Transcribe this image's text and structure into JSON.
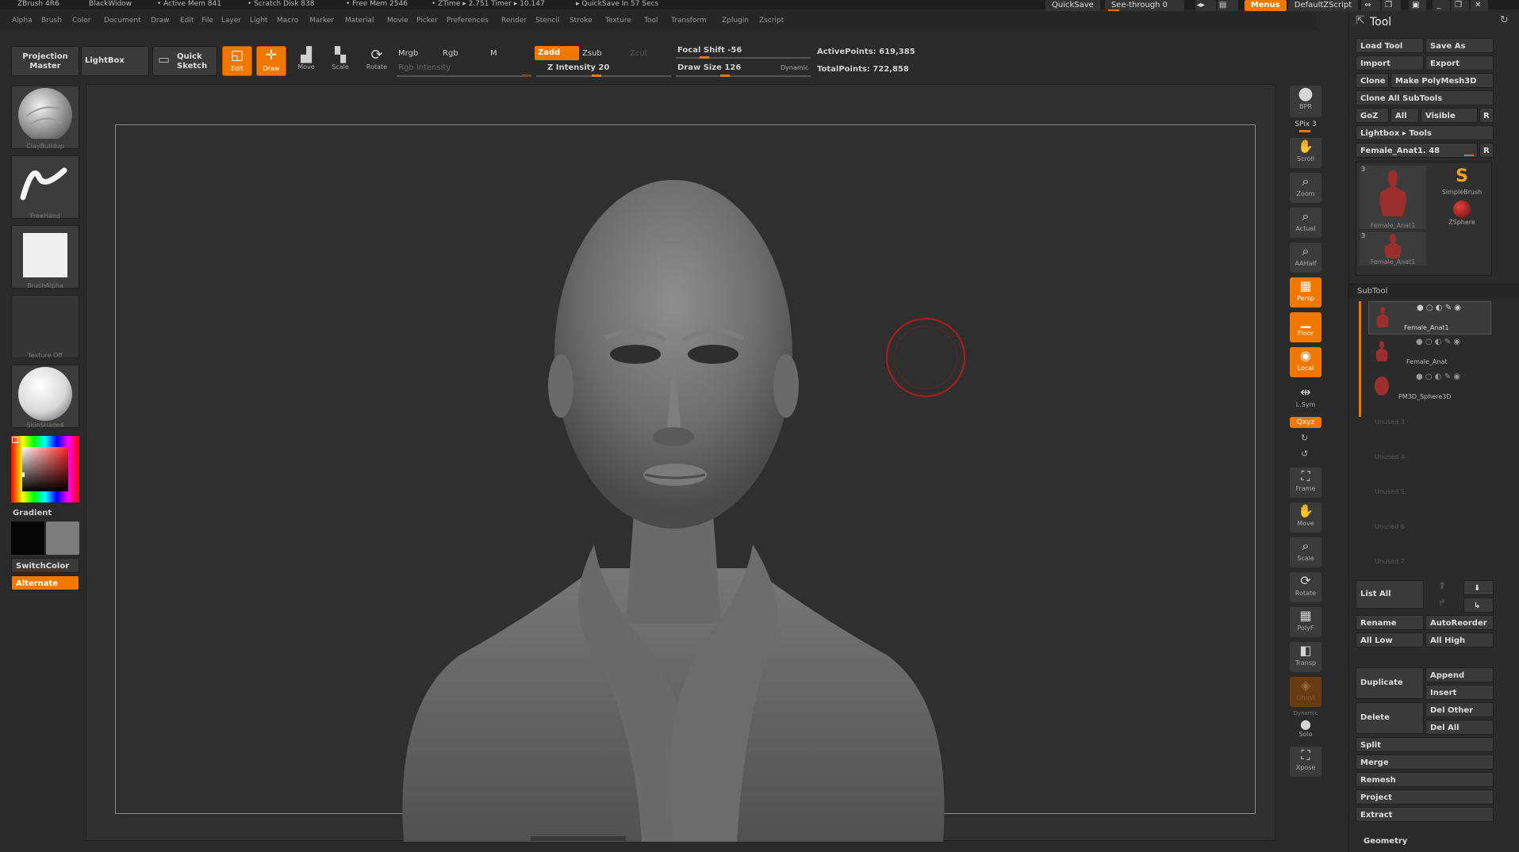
{
  "titlebar": {
    "app": "ZBrush 4R6",
    "doc": "BlackWidow",
    "active_mem": "• Active Mem 841",
    "scratch": "• Scratch Disk 838",
    "free_mem": "• Free Mem 2546",
    "ztime": "• ZTime ▸ 2.751  Timer ▸ 10.147",
    "quicksave_note": "▸ QuickSave In 57 Secs",
    "quicksave_btn": "QuickSave",
    "see_through": "See-through  0",
    "menus": "Menus",
    "default_zscript": "DefaultZScript"
  },
  "menubar": [
    "Alpha",
    "Brush",
    "Color",
    "Document",
    "Draw",
    "Edit",
    "File",
    "Layer",
    "Light",
    "Macro",
    "Marker",
    "Material",
    "Movie",
    "Picker",
    "Preferences",
    "Render",
    "Stencil",
    "Stroke",
    "Texture",
    "Tool",
    "Transform",
    "Zplugin",
    "Zscript"
  ],
  "toolbar": {
    "projection_master": "Projection Master",
    "lightbox": "LightBox",
    "quick_sketch": "Quick Sketch",
    "edit": "Edit",
    "draw": "Draw",
    "move": "Move",
    "scale": "Scale",
    "rotate": "Rotate",
    "mrgb": "Mrgb",
    "rgb": "Rgb",
    "m": "M",
    "rgb_intensity": "Rgb Intensity",
    "zadd": "Zadd",
    "zsub": "Zsub",
    "zcut": "Zcut",
    "z_intensity": "Z Intensity 20",
    "focal_shift": "Focal Shift -56",
    "draw_size": "Draw Size 126",
    "dynamic": "Dynamic",
    "active_points": "ActivePoints: 619,385",
    "total_points": "TotalPoints: 722,858"
  },
  "leftshelf": {
    "brush": "ClayBuildup",
    "stroke": "FreeHand",
    "alpha": "BrushAlpha",
    "texture": "Texture Off",
    "material": "SkinShade4",
    "gradient": "Gradient",
    "switchcolor": "SwitchColor",
    "alternate": "Alternate"
  },
  "rightshelf": {
    "bpr": "BPR",
    "spix": "SPix 3",
    "scroll": "Scroll",
    "zoom": "Zoom",
    "actual": "Actual",
    "aahalf": "AAHalf",
    "persp": "Persp",
    "floor": "Floor",
    "local": "Local",
    "lsym": "L.Sym",
    "xyz": "Qxyz",
    "frame": "Frame",
    "move": "Move",
    "scale": "Scale",
    "rotate": "Rotate",
    "polyf": "PolyF",
    "transp": "Transp",
    "ghost": "Ghost",
    "dynamic": "Dynamic",
    "solo": "Solo",
    "xpose": "Xpose"
  },
  "tool_panel": {
    "title": "Tool",
    "load_tool": "Load Tool",
    "save_as": "Save As",
    "import": "Import",
    "export": "Export",
    "clone": "Clone",
    "make_polymesh": "Make PolyMesh3D",
    "clone_all": "Clone All SubTools",
    "goz": "GoZ",
    "all": "All",
    "visible": "Visible",
    "r": "R",
    "lightbox_tools": "Lightbox ▸ Tools",
    "current_tool": "Female_Anat1. 48",
    "thumb1_count": "3",
    "thumb1_label": "Female_Anat1",
    "simplebrush": "SimpleBrush",
    "zsphere": "ZSphere",
    "thumb2_count": "3",
    "thumb2_label": "Female_Anat1",
    "subtool_header": "SubTool",
    "subtools": [
      "Female_Anat1",
      "Female_Anat",
      "PM3D_Sphere3D"
    ],
    "unused": [
      "Unused 3",
      "Unused 4",
      "Unused 5",
      "Unused 6",
      "Unused 7"
    ],
    "list_all": "List All",
    "rename": "Rename",
    "autoreorder": "AutoReorder",
    "all_low": "All Low",
    "all_high": "All High",
    "duplicate": "Duplicate",
    "append": "Append",
    "insert": "Insert",
    "delete": "Delete",
    "del_other": "Del Other",
    "del_all": "Del All",
    "split": "Split",
    "merge": "Merge",
    "remesh": "Remesh",
    "project": "Project",
    "extract": "Extract",
    "geometry": "Geometry"
  },
  "colors": {
    "accent": "#f07800",
    "background": "#2a2a2a",
    "canvas": "#2f2f2f"
  }
}
